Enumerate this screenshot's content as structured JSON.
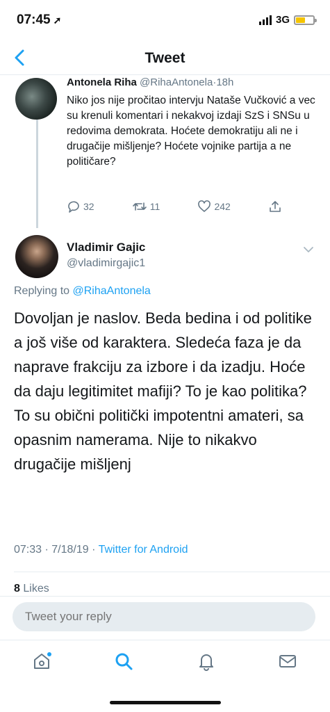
{
  "status_bar": {
    "time": "07:45",
    "network": "3G"
  },
  "nav": {
    "title": "Tweet"
  },
  "parent_tweet": {
    "name": "Antonela Riha",
    "handle": "@RihaAntonela",
    "age": "18h",
    "text": "Niko jos nije pročitao intervju Nataše Vučković a vec su krenuli komentari i nekakvoj izdaji SzS i SNSu u redovima demokrata. Hoćete demokratiju ali ne i drugačije mišljenje? Hoćete vojnike partija a ne političare?",
    "replies": "32",
    "retweets": "11",
    "likes": "242"
  },
  "main_tweet": {
    "name": "Vladimir Gajic",
    "handle": "@vladimirgajic1",
    "replying_prefix": "Replying to",
    "replying_to": "@RihaAntonela",
    "text": "Dovoljan je naslov. Beda bedina i od politike a još više od karaktera. Sledeća faza je da naprave frakciju za izbore i da izadju. Hoće da daju legitimitet mafiji? To je kao politika?To su obični politički impotentni amateri, sa opasnim namerama. Nije to nikakvo drugačije mišljenj",
    "timestamp": "07:33 · 7/18/19 ·",
    "source": "Twitter for Android",
    "likes_count": "8",
    "likes_label": "Likes"
  },
  "reply": {
    "placeholder": "Tweet your reply"
  },
  "colors": {
    "accent": "#1da1f2",
    "muted": "#657786",
    "text": "#14171a"
  },
  "icons": [
    "back-chevron-icon",
    "reply-icon",
    "retweet-icon",
    "like-icon",
    "share-icon",
    "chevron-down-icon",
    "home-icon",
    "search-icon",
    "notifications-icon",
    "messages-icon"
  ]
}
